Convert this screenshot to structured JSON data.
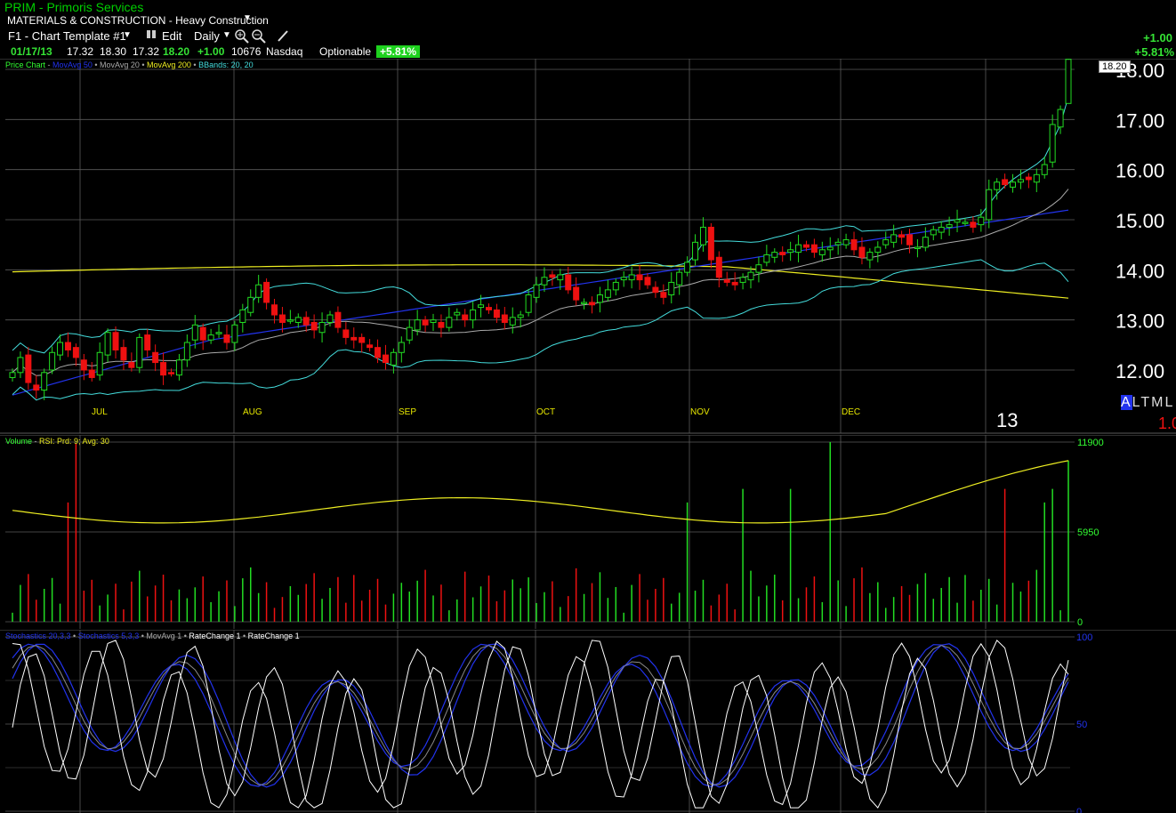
{
  "header": {
    "symbol_title": "PRIM - Primoris Services",
    "industry": "MATERIALS & CONSTRUCTION - Heavy Construction",
    "template": "F1 - Chart Template #1",
    "edit_label": "Edit",
    "period": "Daily",
    "quote": {
      "date": "01/17/13",
      "open": "17.32",
      "high": "18.30",
      "low": "17.32",
      "close": "18.20",
      "change": "+1.00",
      "volume": "10676",
      "exchange": "Nasdaq",
      "optionable": "Optionable",
      "pct_change": "+5.81%"
    },
    "right_change": "+1.00",
    "right_pct": "+5.81%"
  },
  "price_pane": {
    "legend": [
      {
        "text": "Price Chart",
        "color": "#33ff33"
      },
      {
        "text": "MovAvg 50",
        "color": "#2233ee"
      },
      {
        "text": "MovAvg 20",
        "color": "#aaaaaa"
      },
      {
        "text": "MovAvg 200",
        "color": "#eeee22"
      },
      {
        "text": "BBands: 20, 20",
        "color": "#44dddd"
      }
    ],
    "last_price_tag": "18.20",
    "y_ticks": [
      "18.00",
      "17.00",
      "16.00",
      "15.00",
      "14.00",
      "13.00",
      "12.00"
    ],
    "months": [
      "JUL",
      "AUG",
      "SEP",
      "OCT",
      "NOV",
      "DEC"
    ],
    "year_label": "13",
    "altml": "ALTML",
    "altml_value": "1.0"
  },
  "volume_pane": {
    "legend": [
      {
        "text": "Volume",
        "color": "#33ff33"
      },
      {
        "text": "RSI: Prd: 9; Avg: 30",
        "color": "#eeee22"
      }
    ],
    "y_ticks": [
      "11900",
      "5950",
      "0"
    ]
  },
  "osc_pane": {
    "legend": [
      {
        "text": "Stochastics 20,3,3",
        "color": "#2233ee"
      },
      {
        "text": "Stochastics 5,3,3",
        "color": "#2233ee"
      },
      {
        "text": "MovAvg 1",
        "color": "#aaaaaa"
      },
      {
        "text": "RateChange 1",
        "color": "#ffffff"
      },
      {
        "text": "RateChange 1",
        "color": "#ffffff"
      }
    ],
    "y_ticks": [
      "100",
      "50",
      "0"
    ]
  },
  "colors": {
    "up": "#22dd22",
    "down": "#ee1111",
    "ma50": "#2233ee",
    "ma20": "#aaaaaa",
    "ma200": "#eeee22",
    "bbands": "#44dddd",
    "grid": "#5a5a5a"
  },
  "chart_data": {
    "type": "candlestick",
    "months": [
      "JUL",
      "AUG",
      "SEP",
      "OCT",
      "NOV",
      "DEC"
    ],
    "ylim": [
      11.5,
      18.4
    ],
    "close": [
      11.95,
      12.25,
      11.75,
      11.6,
      11.95,
      12.35,
      12.55,
      12.4,
      12.25,
      12.0,
      11.85,
      12.35,
      12.75,
      12.4,
      12.2,
      12.05,
      12.65,
      12.4,
      12.15,
      11.9,
      11.95,
      12.2,
      12.55,
      12.9,
      12.6,
      12.7,
      12.75,
      12.55,
      12.9,
      13.2,
      13.45,
      13.7,
      13.35,
      13.1,
      12.95,
      13.0,
      13.05,
      12.9,
      12.8,
      12.95,
      13.1,
      12.85,
      12.65,
      12.6,
      12.55,
      12.45,
      12.25,
      12.15,
      12.35,
      12.55,
      12.85,
      13.0,
      12.9,
      13.0,
      12.85,
      13.05,
      13.15,
      13.0,
      13.2,
      13.3,
      13.2,
      13.05,
      12.95,
      13.05,
      13.1,
      13.5,
      13.7,
      13.85,
      13.85,
      13.9,
      13.6,
      13.4,
      13.35,
      13.3,
      13.5,
      13.6,
      13.75,
      13.85,
      13.9,
      13.8,
      13.7,
      13.55,
      13.45,
      13.75,
      13.95,
      14.15,
      14.55,
      14.85,
      14.2,
      13.85,
      13.75,
      13.7,
      13.85,
      13.95,
      14.1,
      14.3,
      14.35,
      14.3,
      14.4,
      14.5,
      14.45,
      14.35,
      14.4,
      14.45,
      14.55,
      14.6,
      14.4,
      14.25,
      14.35,
      14.45,
      14.6,
      14.7,
      14.65,
      14.5,
      14.45,
      14.65,
      14.8,
      14.85,
      14.9,
      15.0,
      14.95,
      14.85,
      15.05,
      15.6,
      15.75,
      15.7,
      15.75,
      15.8,
      15.8,
      15.9,
      16.1,
      16.9,
      17.2,
      18.2
    ],
    "last": {
      "open": 17.32,
      "high": 18.3,
      "low": 17.32,
      "close": 18.2
    },
    "volume_ylim": [
      0,
      11900
    ],
    "osc_ylim": [
      0,
      100
    ]
  }
}
